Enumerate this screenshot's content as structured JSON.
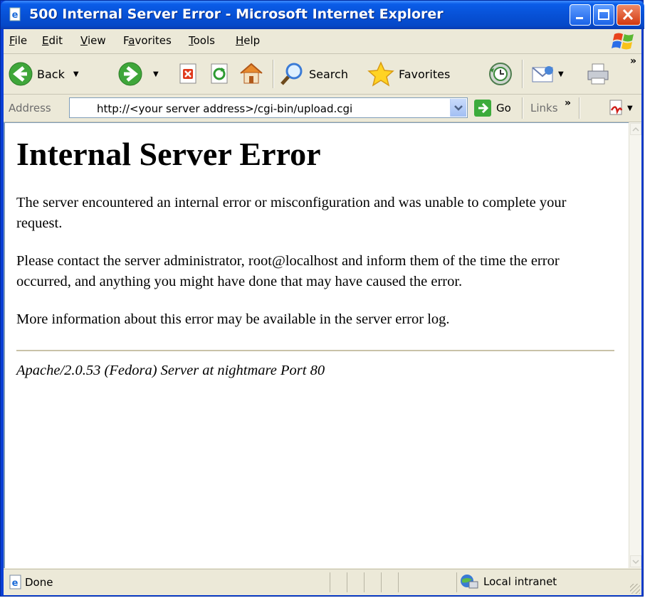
{
  "window": {
    "title": "500 Internal Server Error - Microsoft Internet Explorer",
    "icon": "ie-page-icon",
    "buttons": [
      "minimize-icon",
      "maximize-icon",
      "close-icon"
    ]
  },
  "menu": {
    "items": [
      {
        "label": "File",
        "accel": "F"
      },
      {
        "label": "Edit",
        "accel": "E"
      },
      {
        "label": "View",
        "accel": "V"
      },
      {
        "label": "Favorites",
        "accel": "a"
      },
      {
        "label": "Tools",
        "accel": "T"
      },
      {
        "label": "Help",
        "accel": "H"
      }
    ]
  },
  "toolbar": {
    "back_label": "Back",
    "search_label": "Search",
    "favorites_label": "Favorites",
    "overflow": "»"
  },
  "address": {
    "label": "Address",
    "url": "http://<your server address>/cgi-bin/upload.cgi",
    "go_label": "Go",
    "links_label": "Links",
    "links_overflow": "»"
  },
  "page": {
    "heading": "Internal Server Error",
    "paragraphs": [
      "The server encountered an internal error or misconfiguration and was unable to complete your request.",
      "Please contact the server administrator, root@localhost and inform them of the time the error occurred, and anything you might have done that may have caused the error.",
      "More information about this error may be available in the server error log."
    ],
    "footer": "Apache/2.0.53 (Fedora) Server at nightmare Port 80"
  },
  "status": {
    "text": "Done",
    "zone": "Local intranet"
  },
  "colors": {
    "titlebar": "#0a5ce8",
    "chrome": "#ece9d8",
    "page_bg": "#ffffff"
  }
}
